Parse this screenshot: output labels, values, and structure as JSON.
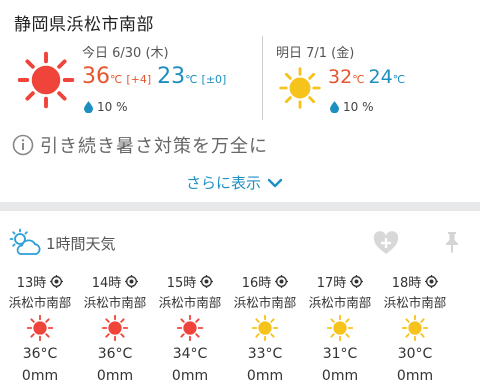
{
  "location": "静岡県浜松市南部",
  "today": {
    "date": "今日 6/30 (木)",
    "weather_icon": "sun-red-icon",
    "high": "36",
    "high_unit": "℃",
    "high_diff": "[+4]",
    "low": "23",
    "low_unit": "℃",
    "low_diff": "[±0]",
    "rain": "10 %"
  },
  "tomorrow": {
    "date": "明日 7/1 (金)",
    "weather_icon": "sun-yellow-icon",
    "high": "32",
    "high_unit": "℃",
    "low": "24",
    "low_unit": "℃",
    "rain": "10 %"
  },
  "notice": "引き続き暑さ対策を万全に",
  "more_label": "さらに表示",
  "hourly": {
    "title": "1時間天気",
    "items": [
      {
        "time": "13時",
        "place": "浜松市南部",
        "icon": "sun-red-icon",
        "temp": "36°C",
        "rain": "0mm"
      },
      {
        "time": "14時",
        "place": "浜松市南部",
        "icon": "sun-red-icon",
        "temp": "36°C",
        "rain": "0mm"
      },
      {
        "time": "15時",
        "place": "浜松市南部",
        "icon": "sun-red-icon",
        "temp": "34°C",
        "rain": "0mm"
      },
      {
        "time": "16時",
        "place": "浜松市南部",
        "icon": "sun-yellow-icon",
        "temp": "33°C",
        "rain": "0mm"
      },
      {
        "time": "17時",
        "place": "浜松市南部",
        "icon": "sun-yellow-icon",
        "temp": "31°C",
        "rain": "0mm"
      },
      {
        "time": "18時",
        "place": "浜松市南部",
        "icon": "sun-yellow-icon",
        "temp": "30°C",
        "rain": "0mm"
      }
    ]
  },
  "colors": {
    "hot": "#e4572e",
    "cool": "#1d8fbf",
    "sun_red": "#f0433a",
    "sun_yellow": "#f6c21c",
    "link": "#1f8fc4"
  }
}
